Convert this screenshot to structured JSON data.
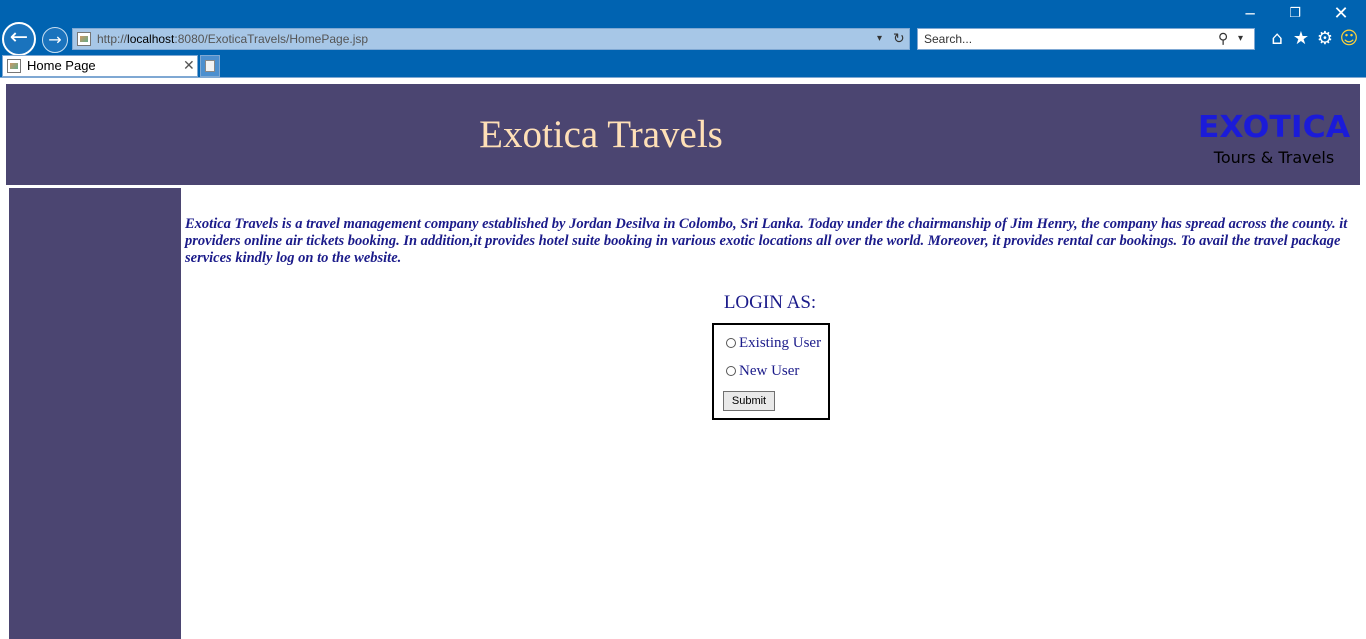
{
  "browser": {
    "url_prefix": "http://",
    "url_host": "localhost",
    "url_path": ":8080/ExoticaTravels/HomePage.jsp",
    "search_placeholder": "Search...",
    "tab_title": "Home Page",
    "window_controls": {
      "minimize": "─",
      "restore": "❐",
      "close": "✕"
    },
    "icons": {
      "back": "←",
      "forward": "→",
      "home": "⌂",
      "favorites": "★",
      "settings": "⚙",
      "feedback": "☺",
      "search": "⚲",
      "dropdown": "▾",
      "refresh": "↻",
      "tab_close": "✕"
    }
  },
  "header": {
    "title": "Exotica Travels",
    "logo_text": "EXOTICA",
    "logo_subtext": "Tours & Travels"
  },
  "main": {
    "description": "Exotica Travels is a travel management company established by Jordan Desilva in Colombo, Sri Lanka. Today under the chairmanship of Jim Henry, the company has spread across the county. it providers online air tickets booking. In addition,it provides hotel suite booking in various exotic locations all over the world. Moreover, it provides rental car bookings. To avail the travel package services kindly log on to the website.",
    "login_heading": "LOGIN AS:",
    "options": [
      "Existing User",
      "New User"
    ],
    "submit_label": "Submit"
  },
  "colors": {
    "chrome": "#0063b1",
    "header_bg": "#4b4571",
    "title_text": "#ffe0b7",
    "logo_text": "#1b1bd8",
    "body_text": "#1b1b8a"
  }
}
